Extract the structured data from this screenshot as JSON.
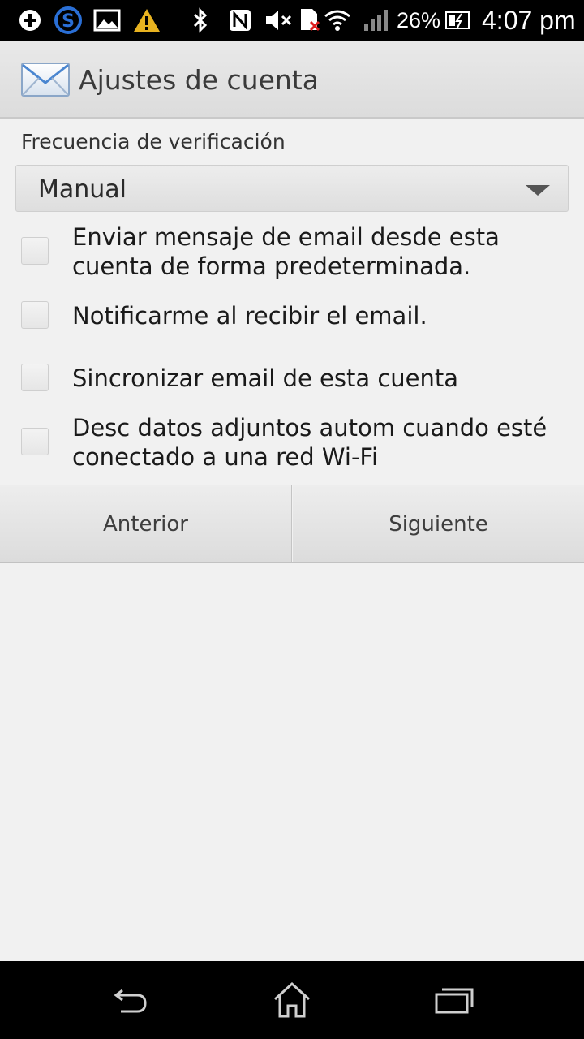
{
  "status_bar": {
    "battery_percent": "26%",
    "time": "4:07 pm",
    "icons": [
      "plus-circle-icon",
      "skype-icon",
      "image-icon",
      "warning-icon",
      "bluetooth-icon",
      "nfc-icon",
      "mute-icon",
      "sim-error-icon",
      "wifi-icon",
      "signal-icon",
      "battery-icon"
    ]
  },
  "action_bar": {
    "title": "Ajustes de cuenta",
    "icon": "email-icon"
  },
  "check_frequency": {
    "label": "Frecuencia de verificación",
    "selected": "Manual"
  },
  "options": [
    {
      "label": "Enviar mensaje de email desde esta cuenta de forma predeterminada.",
      "checked": false
    },
    {
      "label": "Notificarme al recibir el email.",
      "checked": false
    },
    {
      "label": "Sincronizar email de esta cuenta",
      "checked": false
    },
    {
      "label": "Desc datos adjuntos autom cuando esté conectado a una red Wi-Fi",
      "checked": false
    }
  ],
  "buttons": {
    "previous": "Anterior",
    "next": "Siguiente"
  },
  "nav_bar": {
    "icons": [
      "back-icon",
      "home-icon",
      "recent-apps-icon"
    ]
  }
}
